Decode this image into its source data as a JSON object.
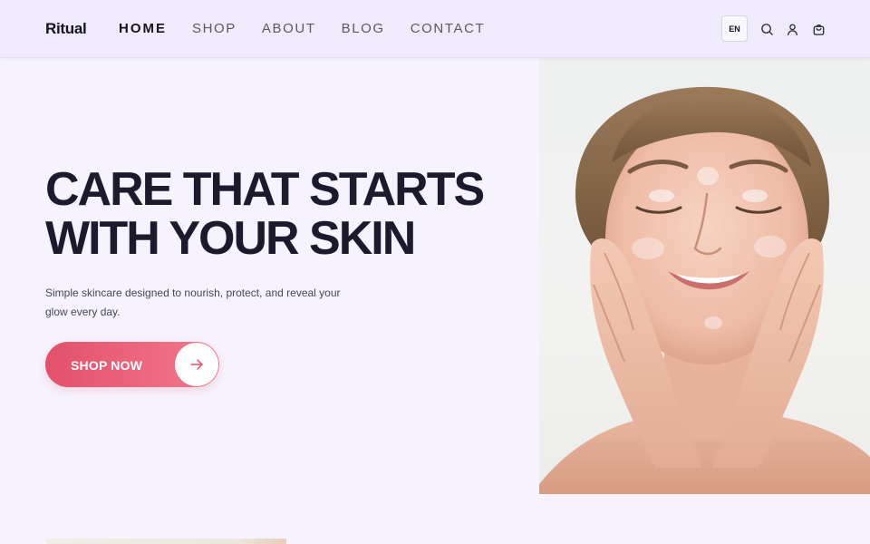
{
  "brand": {
    "name": "Ritual"
  },
  "nav": {
    "items": [
      {
        "label": "HOME",
        "active": true
      },
      {
        "label": "SHOP",
        "active": false
      },
      {
        "label": "ABOUT",
        "active": false
      },
      {
        "label": "BLOG",
        "active": false
      },
      {
        "label": "CONTACT",
        "active": false
      }
    ]
  },
  "header_actions": {
    "language": "EN",
    "icons": [
      "search-icon",
      "user-icon",
      "bag-icon"
    ]
  },
  "hero": {
    "title_line_1": "CARE THAT STARTS",
    "title_line_2": "WITH YOUR SKIN",
    "subtitle": "Simple skincare designed to nourish, protect, and reveal your glow every day.",
    "cta_label": "SHOP NOW",
    "cta_icon": "arrow-right-icon"
  },
  "colors": {
    "page_bg": "#f6f3fe",
    "header_bg": "#efeafc",
    "heading": "#1d1a2e",
    "accent_start": "#e4506a",
    "accent_end": "#f07a8c"
  }
}
